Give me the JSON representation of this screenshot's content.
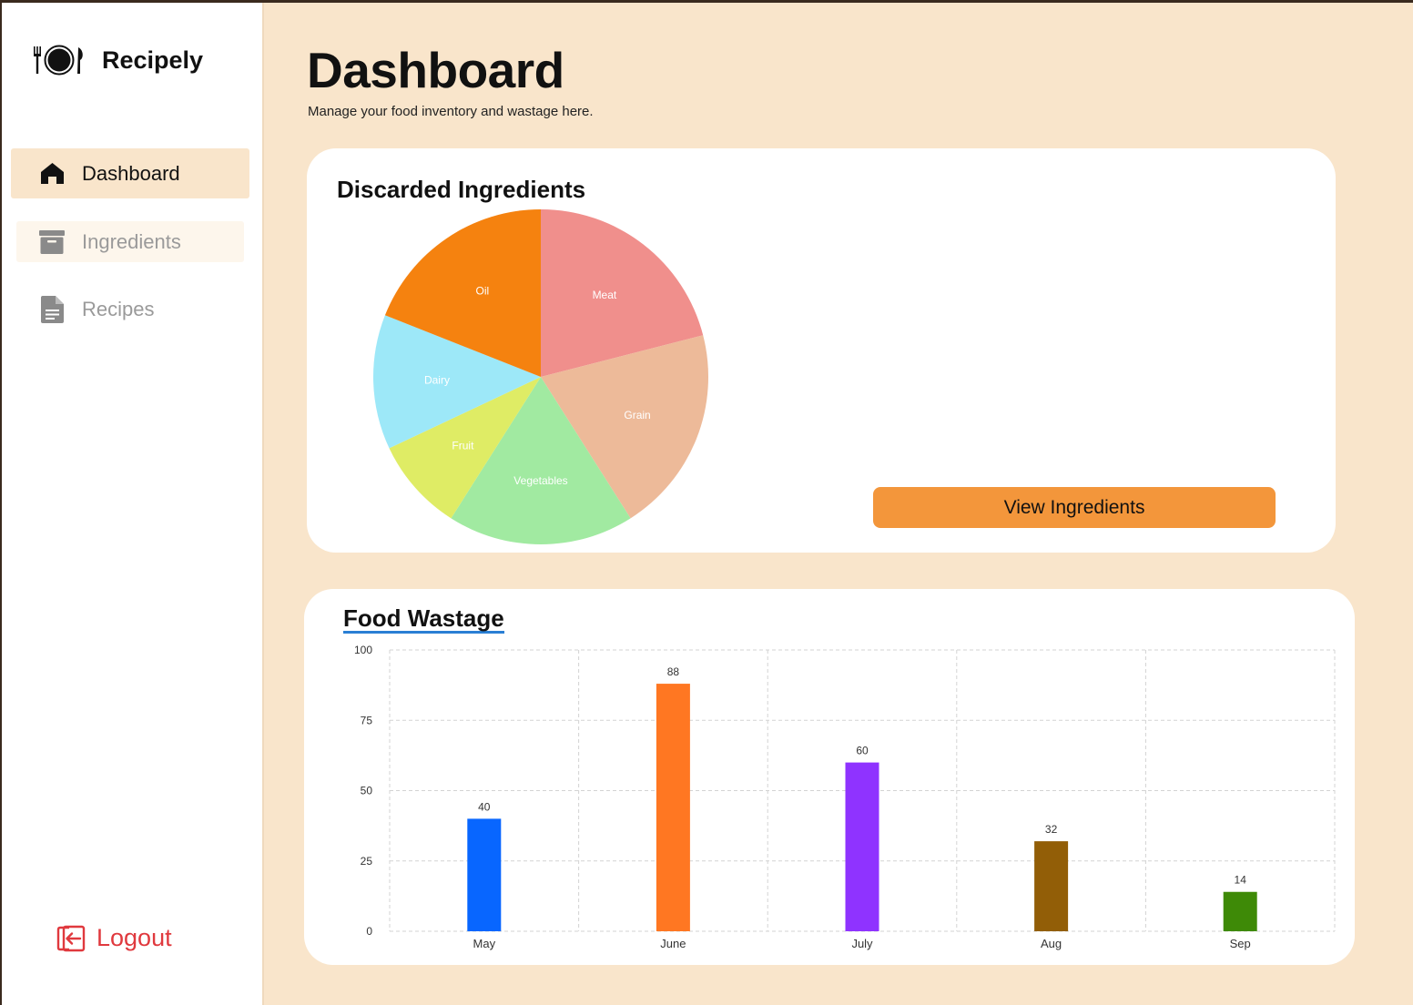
{
  "brand": {
    "name": "Recipely",
    "icon": "plate-cutlery-icon"
  },
  "sidebar": {
    "items": [
      {
        "label": "Dashboard",
        "icon": "home-icon",
        "active": true
      },
      {
        "label": "Ingredients",
        "icon": "archive-box-icon",
        "active": false
      },
      {
        "label": "Recipes",
        "icon": "document-icon",
        "active": false
      }
    ],
    "logout_label": "Logout"
  },
  "header": {
    "title": "Dashboard",
    "subtitle": "Manage your food inventory and wastage here."
  },
  "discarded": {
    "title": "Discarded Ingredients",
    "button_label": "View Ingredients"
  },
  "wastage": {
    "title": "Food Wastage"
  },
  "chart_data": [
    {
      "type": "pie",
      "title": "Discarded Ingredients",
      "slices": [
        {
          "label": "Meat",
          "value": 21,
          "color": "#f08f8c"
        },
        {
          "label": "Grain",
          "value": 20,
          "color": "#edba99"
        },
        {
          "label": "Vegetables",
          "value": 18,
          "color": "#a1eaa1"
        },
        {
          "label": "Fruit",
          "value": 9,
          "color": "#dfec65"
        },
        {
          "label": "Dairy",
          "value": 13,
          "color": "#9de8f8"
        },
        {
          "label": "Oil",
          "value": 19,
          "color": "#f5820f"
        }
      ]
    },
    {
      "type": "bar",
      "title": "Food Wastage",
      "categories": [
        "May",
        "June",
        "July",
        "Aug",
        "Sep"
      ],
      "values": [
        40,
        88,
        60,
        32,
        14
      ],
      "colors": [
        "#0866ff",
        "#ff7722",
        "#8f33ff",
        "#925e07",
        "#3e8a07"
      ],
      "ylim": [
        0,
        100
      ],
      "yticks": [
        0,
        25,
        50,
        75,
        100
      ],
      "grid": true
    }
  ]
}
